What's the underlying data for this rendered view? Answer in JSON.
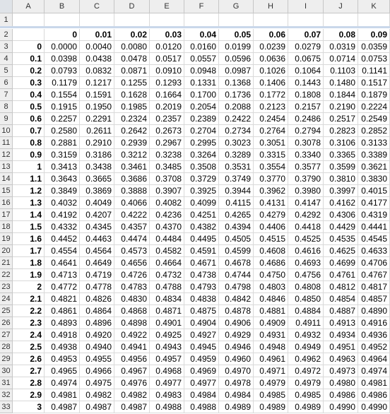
{
  "column_headers": [
    "A",
    "B",
    "C",
    "D",
    "E",
    "F",
    "G",
    "H",
    "I",
    "J",
    "K"
  ],
  "row_numbers": [
    "1",
    "2",
    "3",
    "4",
    "5",
    "6",
    "7",
    "8",
    "9",
    "10",
    "11",
    "12",
    "13",
    "14",
    "15",
    "16",
    "17",
    "18",
    "19",
    "20",
    "21",
    "22",
    "23",
    "24",
    "25",
    "26",
    "27",
    "28",
    "29",
    "30",
    "31",
    "32",
    "33"
  ],
  "header_row": [
    "",
    "0",
    "0.01",
    "0.02",
    "0.03",
    "0.04",
    "0.05",
    "0.06",
    "0.07",
    "0.08",
    "0.09"
  ],
  "data_rows": [
    {
      "z": "0",
      "vals": [
        "0.0000",
        "0.0040",
        "0.0080",
        "0.0120",
        "0.0160",
        "0.0199",
        "0.0239",
        "0.0279",
        "0.0319",
        "0.0359"
      ]
    },
    {
      "z": "0.1",
      "vals": [
        "0.0398",
        "0.0438",
        "0.0478",
        "0.0517",
        "0.0557",
        "0.0596",
        "0.0636",
        "0.0675",
        "0.0714",
        "0.0753"
      ]
    },
    {
      "z": "0.2",
      "vals": [
        "0.0793",
        "0.0832",
        "0.0871",
        "0.0910",
        "0.0948",
        "0.0987",
        "0.1026",
        "0.1064",
        "0.1103",
        "0.1141"
      ]
    },
    {
      "z": "0.3",
      "vals": [
        "0.1179",
        "0.1217",
        "0.1255",
        "0.1293",
        "0.1331",
        "0.1368",
        "0.1406",
        "0.1443",
        "0.1480",
        "0.1517"
      ]
    },
    {
      "z": "0.4",
      "vals": [
        "0.1554",
        "0.1591",
        "0.1628",
        "0.1664",
        "0.1700",
        "0.1736",
        "0.1772",
        "0.1808",
        "0.1844",
        "0.1879"
      ]
    },
    {
      "z": "0.5",
      "vals": [
        "0.1915",
        "0.1950",
        "0.1985",
        "0.2019",
        "0.2054",
        "0.2088",
        "0.2123",
        "0.2157",
        "0.2190",
        "0.2224"
      ]
    },
    {
      "z": "0.6",
      "vals": [
        "0.2257",
        "0.2291",
        "0.2324",
        "0.2357",
        "0.2389",
        "0.2422",
        "0.2454",
        "0.2486",
        "0.2517",
        "0.2549"
      ]
    },
    {
      "z": "0.7",
      "vals": [
        "0.2580",
        "0.2611",
        "0.2642",
        "0.2673",
        "0.2704",
        "0.2734",
        "0.2764",
        "0.2794",
        "0.2823",
        "0.2852"
      ]
    },
    {
      "z": "0.8",
      "vals": [
        "0.2881",
        "0.2910",
        "0.2939",
        "0.2967",
        "0.2995",
        "0.3023",
        "0.3051",
        "0.3078",
        "0.3106",
        "0.3133"
      ]
    },
    {
      "z": "0.9",
      "vals": [
        "0.3159",
        "0.3186",
        "0.3212",
        "0.3238",
        "0.3264",
        "0.3289",
        "0.3315",
        "0.3340",
        "0.3365",
        "0.3389"
      ]
    },
    {
      "z": "1",
      "vals": [
        "0.3413",
        "0.3438",
        "0.3461",
        "0.3485",
        "0.3508",
        "0.3531",
        "0.3554",
        "0.3577",
        "0.3599",
        "0.3621"
      ]
    },
    {
      "z": "1.1",
      "vals": [
        "0.3643",
        "0.3665",
        "0.3686",
        "0.3708",
        "0.3729",
        "0.3749",
        "0.3770",
        "0.3790",
        "0.3810",
        "0.3830"
      ]
    },
    {
      "z": "1.2",
      "vals": [
        "0.3849",
        "0.3869",
        "0.3888",
        "0.3907",
        "0.3925",
        "0.3944",
        "0.3962",
        "0.3980",
        "0.3997",
        "0.4015"
      ]
    },
    {
      "z": "1.3",
      "vals": [
        "0.4032",
        "0.4049",
        "0.4066",
        "0.4082",
        "0.4099",
        "0.4115",
        "0.4131",
        "0.4147",
        "0.4162",
        "0.4177"
      ]
    },
    {
      "z": "1.4",
      "vals": [
        "0.4192",
        "0.4207",
        "0.4222",
        "0.4236",
        "0.4251",
        "0.4265",
        "0.4279",
        "0.4292",
        "0.4306",
        "0.4319"
      ]
    },
    {
      "z": "1.5",
      "vals": [
        "0.4332",
        "0.4345",
        "0.4357",
        "0.4370",
        "0.4382",
        "0.4394",
        "0.4406",
        "0.4418",
        "0.4429",
        "0.4441"
      ]
    },
    {
      "z": "1.6",
      "vals": [
        "0.4452",
        "0.4463",
        "0.4474",
        "0.4484",
        "0.4495",
        "0.4505",
        "0.4515",
        "0.4525",
        "0.4535",
        "0.4545"
      ]
    },
    {
      "z": "1.7",
      "vals": [
        "0.4554",
        "0.4564",
        "0.4573",
        "0.4582",
        "0.4591",
        "0.4599",
        "0.4608",
        "0.4616",
        "0.4625",
        "0.4633"
      ]
    },
    {
      "z": "1.8",
      "vals": [
        "0.4641",
        "0.4649",
        "0.4656",
        "0.4664",
        "0.4671",
        "0.4678",
        "0.4686",
        "0.4693",
        "0.4699",
        "0.4706"
      ]
    },
    {
      "z": "1.9",
      "vals": [
        "0.4713",
        "0.4719",
        "0.4726",
        "0.4732",
        "0.4738",
        "0.4744",
        "0.4750",
        "0.4756",
        "0.4761",
        "0.4767"
      ]
    },
    {
      "z": "2",
      "vals": [
        "0.4772",
        "0.4778",
        "0.4783",
        "0.4788",
        "0.4793",
        "0.4798",
        "0.4803",
        "0.4808",
        "0.4812",
        "0.4817"
      ]
    },
    {
      "z": "2.1",
      "vals": [
        "0.4821",
        "0.4826",
        "0.4830",
        "0.4834",
        "0.4838",
        "0.4842",
        "0.4846",
        "0.4850",
        "0.4854",
        "0.4857"
      ]
    },
    {
      "z": "2.2",
      "vals": [
        "0.4861",
        "0.4864",
        "0.4868",
        "0.4871",
        "0.4875",
        "0.4878",
        "0.4881",
        "0.4884",
        "0.4887",
        "0.4890"
      ]
    },
    {
      "z": "2.3",
      "vals": [
        "0.4893",
        "0.4896",
        "0.4898",
        "0.4901",
        "0.4904",
        "0.4906",
        "0.4909",
        "0.4911",
        "0.4913",
        "0.4916"
      ]
    },
    {
      "z": "2.4",
      "vals": [
        "0.4918",
        "0.4920",
        "0.4922",
        "0.4925",
        "0.4927",
        "0.4929",
        "0.4931",
        "0.4932",
        "0.4934",
        "0.4936"
      ]
    },
    {
      "z": "2.5",
      "vals": [
        "0.4938",
        "0.4940",
        "0.4941",
        "0.4943",
        "0.4945",
        "0.4946",
        "0.4948",
        "0.4949",
        "0.4951",
        "0.4952"
      ]
    },
    {
      "z": "2.6",
      "vals": [
        "0.4953",
        "0.4955",
        "0.4956",
        "0.4957",
        "0.4959",
        "0.4960",
        "0.4961",
        "0.4962",
        "0.4963",
        "0.4964"
      ]
    },
    {
      "z": "2.7",
      "vals": [
        "0.4965",
        "0.4966",
        "0.4967",
        "0.4968",
        "0.4969",
        "0.4970",
        "0.4971",
        "0.4972",
        "0.4973",
        "0.4974"
      ]
    },
    {
      "z": "2.8",
      "vals": [
        "0.4974",
        "0.4975",
        "0.4976",
        "0.4977",
        "0.4977",
        "0.4978",
        "0.4979",
        "0.4979",
        "0.4980",
        "0.4981"
      ]
    },
    {
      "z": "2.9",
      "vals": [
        "0.4981",
        "0.4982",
        "0.4982",
        "0.4983",
        "0.4984",
        "0.4984",
        "0.4985",
        "0.4985",
        "0.4986",
        "0.4986"
      ]
    },
    {
      "z": "3",
      "vals": [
        "0.4987",
        "0.4987",
        "0.4987",
        "0.4988",
        "0.4988",
        "0.4989",
        "0.4989",
        "0.4989",
        "0.4990",
        "0.4990"
      ]
    }
  ]
}
